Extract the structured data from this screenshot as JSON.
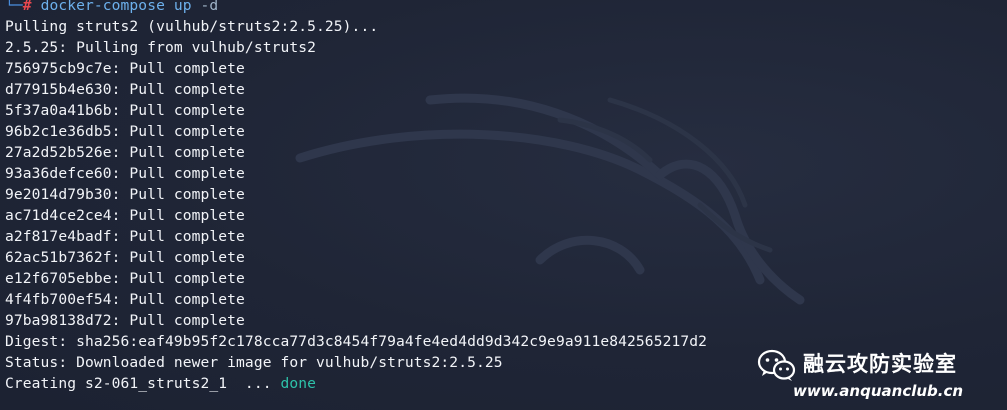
{
  "command": {
    "corner": "└─",
    "hash": "#",
    "text": "docker-compose up ",
    "flag": "-d"
  },
  "output_lines": [
    "Pulling struts2 (vulhub/struts2:2.5.25)...",
    "2.5.25: Pulling from vulhub/struts2",
    "756975cb9c7e: Pull complete",
    "d77915b4e630: Pull complete",
    "5f37a0a41b6b: Pull complete",
    "96b2c1e36db5: Pull complete",
    "27a2d52b526e: Pull complete",
    "93a36defce60: Pull complete",
    "9e2014d79b30: Pull complete",
    "ac71d4ce2ce4: Pull complete",
    "a2f817e4badf: Pull complete",
    "62ac51b7362f: Pull complete",
    "e12f6705ebbe: Pull complete",
    "4f4fb700ef54: Pull complete",
    "97ba98138d72: Pull complete",
    "Digest: sha256:eaf49b95f2c178cca77d3c8454f79a4fe4ed4dd9d342c9e9a911e842565217d2",
    "Status: Downloaded newer image for vulhub/struts2:2.5.25"
  ],
  "creating": {
    "text": "Creating s2-061_struts2_1  ... ",
    "status": "done"
  },
  "watermark": {
    "icon": "wechat-icon",
    "brand": "融云攻防实验室",
    "site": "www.anquanclub.cn"
  },
  "colors": {
    "background": "#1f2536",
    "text": "#f2f4f8",
    "command": "#6db0ec",
    "prompt_hash": "#e8484f",
    "done": "#2ec2a9"
  }
}
